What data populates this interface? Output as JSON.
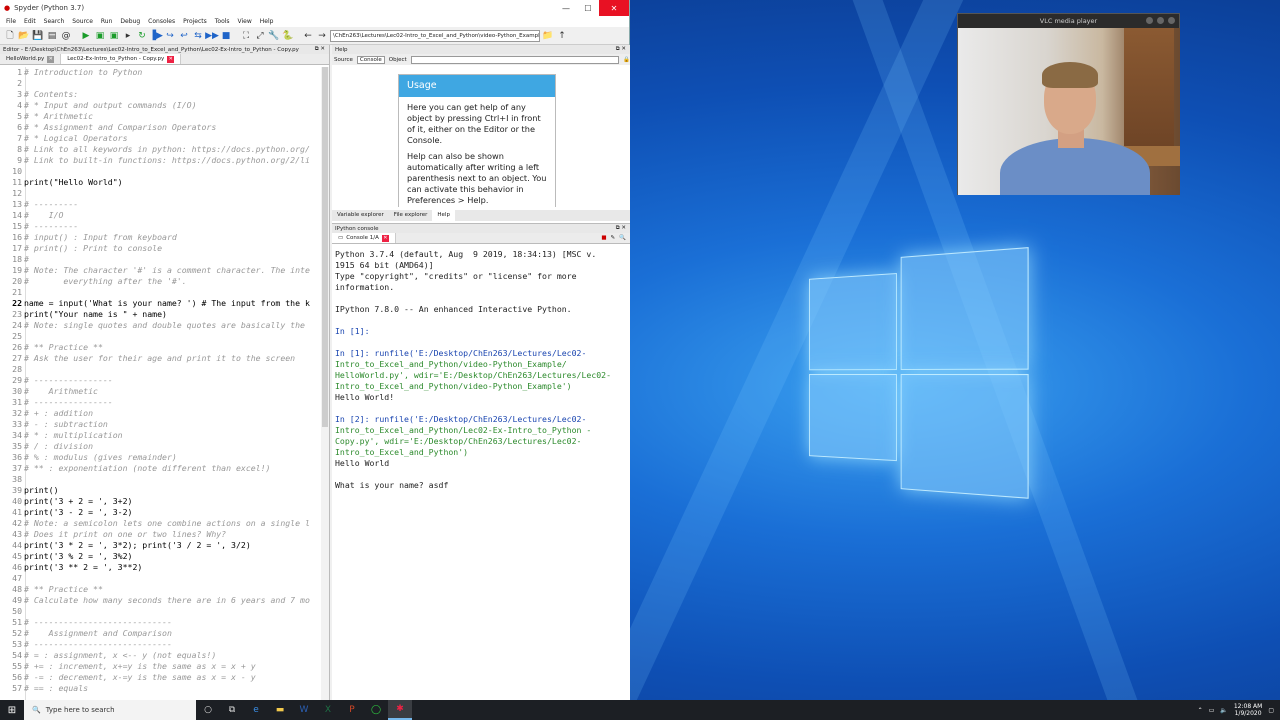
{
  "spyder": {
    "title": "Spyder (Python 3.7)",
    "menu": [
      "File",
      "Edit",
      "Search",
      "Source",
      "Run",
      "Debug",
      "Consoles",
      "Projects",
      "Tools",
      "View",
      "Help"
    ],
    "path": "\\ChEn263\\Lectures\\Lec02-Intro_to_Excel_and_Python\\video-Python_Example",
    "editor_header": "Editor - E:\\Desktop\\ChEn263\\Lectures\\Lec02-Intro_to_Excel_and_Python\\Lec02-Ex-Intro_to_Python - Copy.py",
    "editor_tabs": [
      "HelloWorld.py",
      "Lec02-Ex-Intro_to_Python - Copy.py"
    ],
    "code_lines": [
      {
        "n": "1",
        "t": "# Introduction to Python",
        "c": true
      },
      {
        "n": "2",
        "t": "",
        "c": false
      },
      {
        "n": "3",
        "t": "# Contents:",
        "c": true
      },
      {
        "n": "4",
        "t": "# * Input and output commands (I/O)",
        "c": true
      },
      {
        "n": "5",
        "t": "# * Arithmetic",
        "c": true
      },
      {
        "n": "6",
        "t": "# * Assignment and Comparison Operators",
        "c": true
      },
      {
        "n": "7",
        "t": "# * Logical Operators",
        "c": true
      },
      {
        "n": "8",
        "t": "# Link to all keywords in python: https://docs.python.org/",
        "c": true
      },
      {
        "n": "9",
        "t": "# Link to built-in functions: https://docs.python.org/2/li",
        "c": true
      },
      {
        "n": "10",
        "t": "",
        "c": false
      },
      {
        "n": "11",
        "t": "print(\"Hello World\")",
        "c": false
      },
      {
        "n": "12",
        "t": "",
        "c": false
      },
      {
        "n": "13",
        "t": "# ---------",
        "c": true
      },
      {
        "n": "14",
        "t": "#    I/O",
        "c": true
      },
      {
        "n": "15",
        "t": "# ---------",
        "c": true
      },
      {
        "n": "16",
        "t": "# input() : Input from keyboard",
        "c": true
      },
      {
        "n": "17",
        "t": "# print() : Print to console",
        "c": true
      },
      {
        "n": "18",
        "t": "#",
        "c": true
      },
      {
        "n": "19",
        "t": "# Note: The character '#' is a comment character. The inte",
        "c": true
      },
      {
        "n": "20",
        "t": "#       everything after the '#'.",
        "c": true
      },
      {
        "n": "21",
        "t": "",
        "c": false
      },
      {
        "n": "22",
        "t": "name = input('What is your name? ') # The input from the k",
        "c": false
      },
      {
        "n": "23",
        "t": "print(\"Your name is \" + name)",
        "c": false
      },
      {
        "n": "24",
        "t": "# Note: single quotes and double quotes are basically the ",
        "c": true
      },
      {
        "n": "25",
        "t": "",
        "c": false
      },
      {
        "n": "26",
        "t": "# ** Practice **",
        "c": true
      },
      {
        "n": "27",
        "t": "# Ask the user for their age and print it to the screen",
        "c": true
      },
      {
        "n": "28",
        "t": "",
        "c": false
      },
      {
        "n": "29",
        "t": "# ----------------",
        "c": true
      },
      {
        "n": "30",
        "t": "#    Arithmetic",
        "c": true
      },
      {
        "n": "31",
        "t": "# ----------------",
        "c": true
      },
      {
        "n": "32",
        "t": "# + : addition",
        "c": true
      },
      {
        "n": "33",
        "t": "# - : subtraction",
        "c": true
      },
      {
        "n": "34",
        "t": "# * : multiplication",
        "c": true
      },
      {
        "n": "35",
        "t": "# / : division",
        "c": true
      },
      {
        "n": "36",
        "t": "# % : modulus (gives remainder)",
        "c": true
      },
      {
        "n": "37",
        "t": "# ** : exponentiation (note different than excel!)",
        "c": true
      },
      {
        "n": "38",
        "t": "",
        "c": false
      },
      {
        "n": "39",
        "t": "print()",
        "c": false
      },
      {
        "n": "40",
        "t": "print('3 + 2 = ', 3+2)",
        "c": false
      },
      {
        "n": "41",
        "t": "print('3 - 2 = ', 3-2)",
        "c": false
      },
      {
        "n": "42",
        "t": "# Note: a semicolon lets one combine actions on a single l",
        "c": true
      },
      {
        "n": "43",
        "t": "# Does it print on one or two lines? Why?",
        "c": true
      },
      {
        "n": "44",
        "t": "print('3 * 2 = ', 3*2); print('3 / 2 = ', 3/2)",
        "c": false
      },
      {
        "n": "45",
        "t": "print('3 % 2 = ', 3%2)",
        "c": false
      },
      {
        "n": "46",
        "t": "print('3 ** 2 = ', 3**2)",
        "c": false
      },
      {
        "n": "47",
        "t": "",
        "c": false
      },
      {
        "n": "48",
        "t": "# ** Practice **",
        "c": true
      },
      {
        "n": "49",
        "t": "# Calculate how many seconds there are in 6 years and 7 mo",
        "c": true
      },
      {
        "n": "50",
        "t": "",
        "c": false
      },
      {
        "n": "51",
        "t": "# ----------------------------",
        "c": true
      },
      {
        "n": "52",
        "t": "#    Assignment and Comparison",
        "c": true
      },
      {
        "n": "53",
        "t": "# ----------------------------",
        "c": true
      },
      {
        "n": "54",
        "t": "# = : assignment, x <-- y (not equals!)",
        "c": true
      },
      {
        "n": "55",
        "t": "# += : increment, x+=y is the same as x = x + y",
        "c": true
      },
      {
        "n": "56",
        "t": "# -= : decrement, x-=y is the same as x = x - y",
        "c": true
      },
      {
        "n": "57",
        "t": "# == : equals",
        "c": true
      }
    ],
    "help": {
      "header": "Help",
      "source_label": "Source",
      "source_value": "Console",
      "object_label": "Object",
      "usage_title": "Usage",
      "usage_p1": "Here you can get help of any object by pressing Ctrl+I in front of it, either on the Editor or the Console.",
      "usage_p2": "Help can also be shown automatically after writing a left parenthesis next to an object. You can activate this behavior in Preferences > Help.",
      "tabs": [
        "Variable explorer",
        "File explorer",
        "Help"
      ]
    },
    "console": {
      "header": "IPython console",
      "tab": "Console 1/A",
      "lines": [
        {
          "t": "Python 3.7.4 (default, Aug  9 2019, 18:34:13) [MSC v.",
          "k": "n"
        },
        {
          "t": "1915 64 bit (AMD64)]",
          "k": "n"
        },
        {
          "t": "Type \"copyright\", \"credits\" or \"license\" for more",
          "k": "n"
        },
        {
          "t": "information.",
          "k": "n"
        },
        {
          "t": "",
          "k": "n"
        },
        {
          "t": "IPython 7.8.0 -- An enhanced Interactive Python.",
          "k": "n"
        },
        {
          "t": "",
          "k": "n"
        },
        {
          "t": "In [1]:",
          "k": "in"
        },
        {
          "t": "",
          "k": "n"
        },
        {
          "t": "In [1]: runfile('E:/Desktop/ChEn263/Lectures/Lec02-",
          "k": "in"
        },
        {
          "t": "Intro_to_Excel_and_Python/video-Python_Example/",
          "k": "p"
        },
        {
          "t": "HelloWorld.py', wdir='E:/Desktop/ChEn263/Lectures/Lec02-",
          "k": "p"
        },
        {
          "t": "Intro_to_Excel_and_Python/video-Python_Example')",
          "k": "p"
        },
        {
          "t": "Hello World!",
          "k": "n"
        },
        {
          "t": "",
          "k": "n"
        },
        {
          "t": "In [2]: runfile('E:/Desktop/ChEn263/Lectures/Lec02-",
          "k": "in"
        },
        {
          "t": "Intro_to_Excel_and_Python/Lec02-Ex-Intro_to_Python -",
          "k": "p"
        },
        {
          "t": "Copy.py', wdir='E:/Desktop/ChEn263/Lectures/Lec02-",
          "k": "p"
        },
        {
          "t": "Intro_to_Excel_and_Python')",
          "k": "p"
        },
        {
          "t": "Hello World",
          "k": "n"
        },
        {
          "t": "",
          "k": "n"
        },
        {
          "t": "What is your name? asdf",
          "k": "n"
        }
      ]
    }
  },
  "vlc": {
    "title": "VLC media player"
  },
  "taskbar": {
    "search_placeholder": "Type here to search",
    "time": "12:08 AM",
    "date": "1/9/2020"
  }
}
